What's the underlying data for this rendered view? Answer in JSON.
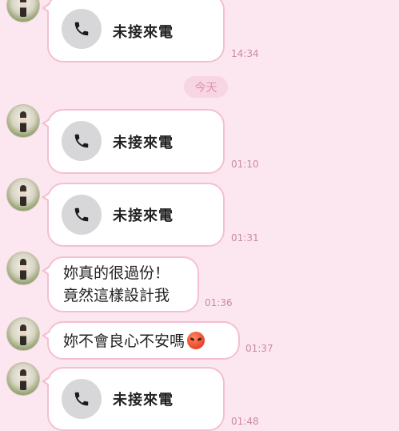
{
  "colors": {
    "background": "#fce7f0",
    "bubble_border": "#f4bfd3",
    "time_text": "#c98aa3",
    "date_pill_bg": "#f8d5e3"
  },
  "date_separator": "今天",
  "messages": [
    {
      "type": "missed_call",
      "label": "未接來電",
      "time": "14:34",
      "icon": "phone-icon"
    },
    {
      "type": "missed_call",
      "label": "未接來電",
      "time": "01:10",
      "icon": "phone-icon"
    },
    {
      "type": "missed_call",
      "label": "未接來電",
      "time": "01:31",
      "icon": "phone-icon"
    },
    {
      "type": "text",
      "lines": [
        "妳真的很過份！",
        "竟然這樣設計我"
      ],
      "time": "01:36"
    },
    {
      "type": "text",
      "lines": [
        "妳不會良心不安嗎"
      ],
      "emoji": "angry-face-emoji",
      "time": "01:37"
    },
    {
      "type": "missed_call",
      "label": "未接來電",
      "time": "01:48",
      "icon": "phone-icon"
    }
  ]
}
